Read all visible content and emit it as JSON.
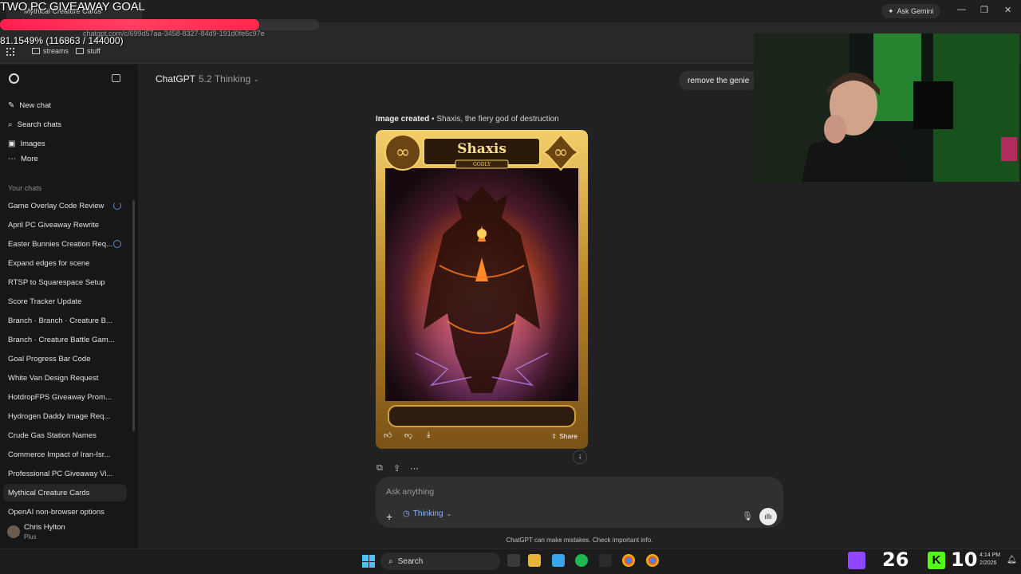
{
  "overlay": {
    "goal_title": "TWO PC GIVEAWAY GOAL",
    "goal_percent_text": "81.1549% (116863 / 144000)",
    "goal_progress": 0.811549
  },
  "browser": {
    "tab_title": "Mythical Creature Cards",
    "url": "chatgpt.com/c/699d57aa-3458-8327-84d9-191d0fe6c97e",
    "bookmarks": [
      "streams",
      "stuff"
    ],
    "ask_gemini": "Ask Gemini"
  },
  "sidebar": {
    "primary": [
      {
        "label": "New chat",
        "icon": "edit-icon"
      },
      {
        "label": "Search chats",
        "icon": "search-icon"
      },
      {
        "label": "Images",
        "icon": "image-icon"
      },
      {
        "label": "More",
        "icon": "more-icon"
      }
    ],
    "section_label": "Your chats",
    "chats": [
      "Game Overlay Code Review",
      "April PC Giveaway Rewrite",
      "Easter Bunnies Creation Req...",
      "Expand edges for scene",
      "RTSP to Squarespace Setup",
      "Score Tracker Update",
      "Branch · Branch · Creature B...",
      "Branch · Creature Battle Gam...",
      "Goal Progress Bar Code",
      "White Van Design Request",
      "HotdropFPS Giveaway Prom...",
      "Hydrogen Daddy Image Req...",
      "Crude Gas Station Names",
      "Commerce Impact of Iran-Isr...",
      "Professional PC Giveaway Vi...",
      "Mythical Creature Cards",
      "OpenAI non-browser options"
    ],
    "user_name": "Chris Hylton",
    "user_plan": "Plus"
  },
  "main": {
    "model_name": "ChatGPT",
    "model_version": "5.2 Thinking",
    "user_message": "remove the genie",
    "image_caption_bold": "Image created",
    "image_caption_rest": " • Shaxis, the fiery god of destruction",
    "card_name": "Shaxis",
    "card_rank": "GODLY",
    "share_label": "Share",
    "composer_placeholder": "Ask anything",
    "thinking_label": "Thinking",
    "disclaimer": "ChatGPT can make mistakes. Check important info."
  },
  "taskbar": {
    "search_label": "Search",
    "counter_left": "26",
    "counter_right": "10",
    "time": "4:14 PM",
    "date": "2/2026"
  },
  "colors": {
    "sidebar_bg": "#171717",
    "main_bg": "#212121",
    "accent_blue": "#8ab4f8",
    "goal_bar": "#ff2a4a",
    "card_gold": "#d4a23a"
  }
}
